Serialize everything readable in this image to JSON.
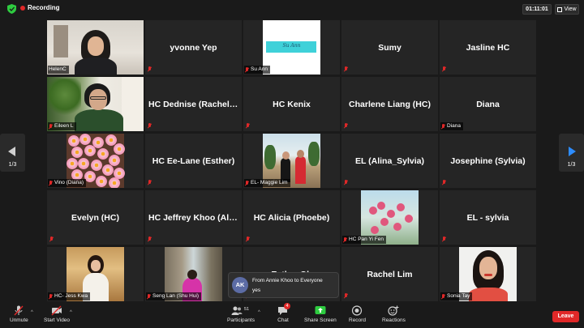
{
  "topbar": {
    "recording_label": "Recording",
    "timer": "01:11:01",
    "view_label": "View"
  },
  "nav": {
    "left_page": "1/3",
    "right_page": "1/3"
  },
  "tiles": [
    {
      "name": "HelenC",
      "display_name": "",
      "video": true,
      "muted": false
    },
    {
      "name": "",
      "display_name": "yvonne Yep",
      "video": false,
      "muted": true
    },
    {
      "name": "Su Ann",
      "display_name": "",
      "video": true,
      "muted": true,
      "sign_text": "Su Ann"
    },
    {
      "name": "",
      "display_name": "Sumy",
      "video": false,
      "muted": true
    },
    {
      "name": "",
      "display_name": "Jasline HC",
      "video": false,
      "muted": true
    },
    {
      "name": "Eileen L",
      "display_name": "",
      "video": true,
      "muted": true
    },
    {
      "name": "",
      "display_name": "HC Dednise (Rachel L...",
      "video": false,
      "muted": true
    },
    {
      "name": "",
      "display_name": "HC Kenix",
      "video": false,
      "muted": true
    },
    {
      "name": "",
      "display_name": "Charlene Liang (HC)",
      "video": false,
      "muted": true
    },
    {
      "name": "Diana",
      "display_name": "Diana",
      "video": false,
      "muted": true
    },
    {
      "name": "Vino (Diana)",
      "display_name": "",
      "video": true,
      "muted": true
    },
    {
      "name": "",
      "display_name": "HC Ee-Lane (Esther)",
      "video": false,
      "muted": true
    },
    {
      "name": "EL- Maggie Lim",
      "display_name": "",
      "video": true,
      "muted": true
    },
    {
      "name": "",
      "display_name": "EL (Alina_Sylvia)",
      "video": false,
      "muted": true
    },
    {
      "name": "",
      "display_name": "Josephine (Sylvia)",
      "video": false,
      "muted": true
    },
    {
      "name": "",
      "display_name": "Evelyn (HC)",
      "video": false,
      "muted": true
    },
    {
      "name": "",
      "display_name": "HC Jeffrey Khoo (Alici...",
      "video": false,
      "muted": true
    },
    {
      "name": "",
      "display_name": "HC Alicia (Phoebe)",
      "video": false,
      "muted": true
    },
    {
      "name": "HC Pan Yi Fen",
      "display_name": "",
      "video": true,
      "muted": true
    },
    {
      "name": "",
      "display_name": "EL - sylvia",
      "video": false,
      "muted": true
    },
    {
      "name": "HC- Jess Kwa",
      "display_name": "",
      "video": true,
      "muted": true
    },
    {
      "name": "Seng Lan (Shu Hui)",
      "display_name": "",
      "video": true,
      "muted": true
    },
    {
      "name": "",
      "display_name": "Esther Oh",
      "video": false,
      "muted": true
    },
    {
      "name": "",
      "display_name": "Rachel Lim",
      "video": false,
      "muted": true
    },
    {
      "name": "Sonia Tay",
      "display_name": "",
      "video": true,
      "muted": true
    }
  ],
  "chat_popup": {
    "avatar_initials": "AK",
    "from": "From Annie Khoo to Everyone",
    "message": "yes"
  },
  "toolbar": {
    "unmute": "Unmute",
    "start_video": "Start Video",
    "participants": "Participants",
    "participants_count": "51",
    "chat": "Chat",
    "chat_badge": "4",
    "share_screen": "Share Screen",
    "record": "Record",
    "reactions": "Reactions",
    "leave": "Leave"
  },
  "colors": {
    "active_speaker": "#c6e84a",
    "share_green": "#2ecc40",
    "leave_red": "#e02828",
    "nav_blue": "#2d8cff"
  }
}
